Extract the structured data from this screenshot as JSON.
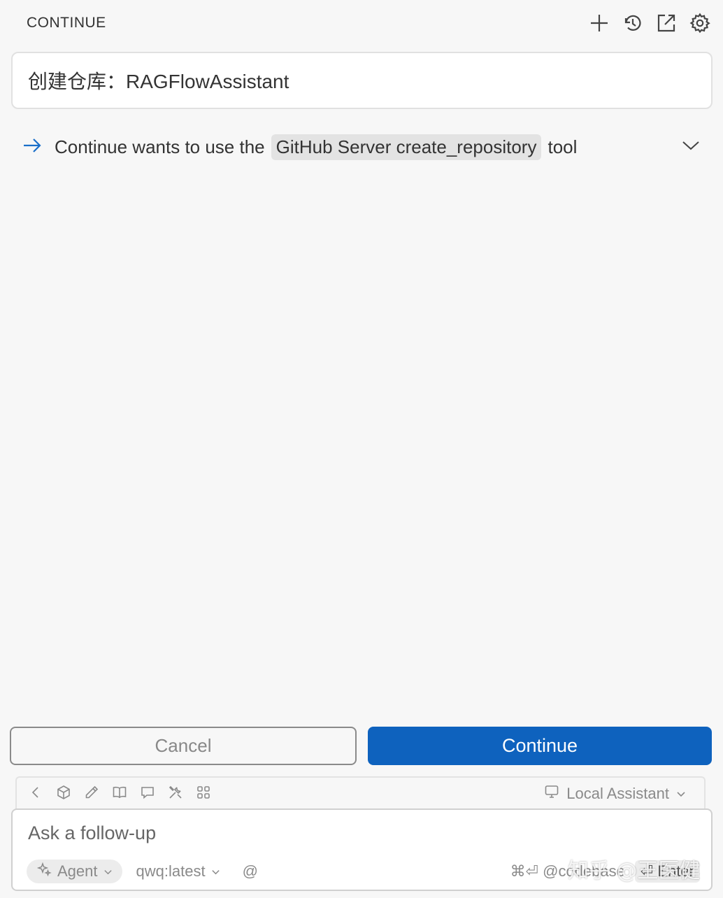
{
  "header": {
    "title": "CONTINUE",
    "actions": [
      "plus-icon",
      "history-icon",
      "open-external-icon",
      "gear-icon"
    ]
  },
  "user_message": {
    "text": "创建仓库：RAGFlowAssistant"
  },
  "tool_call": {
    "prefix": "Continue wants to use the",
    "tool_name": "GitHub Server create_repository",
    "suffix": "tool"
  },
  "actions": {
    "cancel_label": "Cancel",
    "continue_label": "Continue"
  },
  "toolbar": {
    "icons": [
      "back-icon",
      "cube-icon",
      "pencil-icon",
      "book-icon",
      "chat-icon",
      "tools-icon",
      "grid-icon"
    ],
    "assistant_label": "Local Assistant"
  },
  "input": {
    "placeholder": "Ask a follow-up",
    "mode_label": "Agent",
    "model_label": "qwq:latest",
    "at_symbol": "@",
    "codebase_shortcut": "⌘⏎ @codebase",
    "enter_label": "⏎ Enter"
  },
  "watermark": {
    "text": "知乎 @王医健"
  }
}
